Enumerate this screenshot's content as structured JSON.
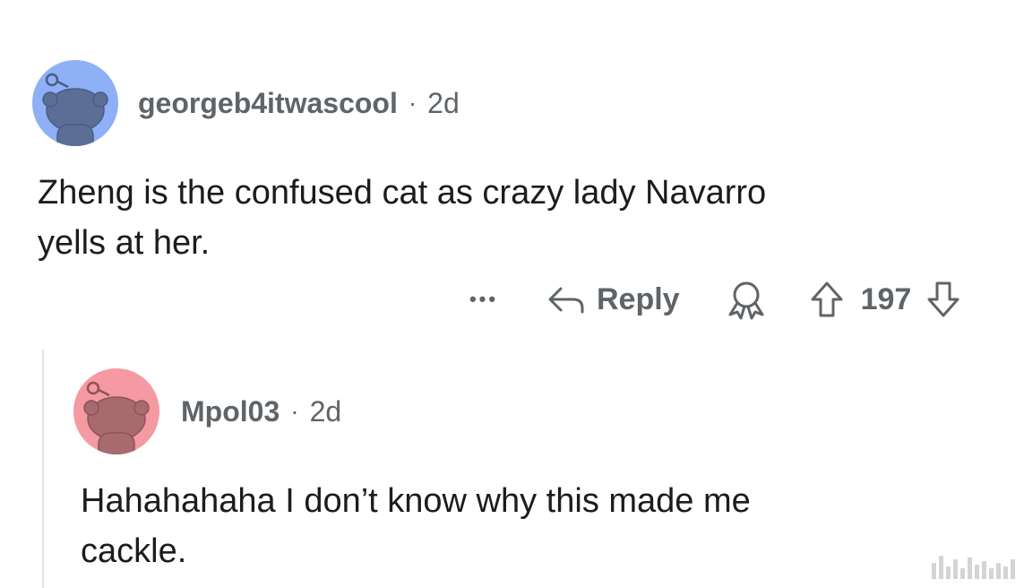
{
  "parent_comment": {
    "username": "georgeb4itwascool",
    "separator": "·",
    "age": "2d",
    "avatar_color": "#8fb0f7",
    "body_line1": "Zheng is the confused cat as crazy lady Navarro",
    "body_line2": "yells at her."
  },
  "actions": {
    "more_label": "•••",
    "reply_label": "Reply",
    "vote_count": "197"
  },
  "reply_comment": {
    "username": "Mpol03",
    "separator": "·",
    "age": "2d",
    "avatar_color": "#f59aa2",
    "body_line1": "Hahahahaha I don’t know why this made me",
    "body_line2": "cackle."
  },
  "colors": {
    "meta_text": "#5f6468",
    "body_text": "#1c1c1c",
    "thread_line": "#e3e3e3"
  },
  "icons": [
    "snoo-avatar",
    "reply-arrow-icon",
    "award-icon",
    "upvote-icon",
    "downvote-icon"
  ]
}
